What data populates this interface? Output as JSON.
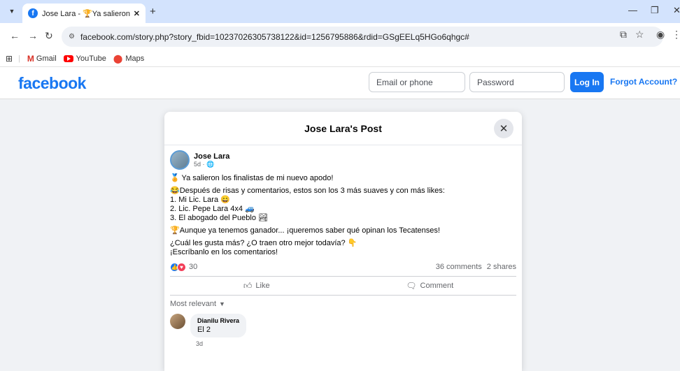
{
  "browser": {
    "tab_title": "Jose Lara - 🏆Ya salieron los fin...",
    "tab_close": "✕",
    "new_tab": "+",
    "url": "facebook.com/story.php?story_fbid=10237026305738122&id=1256795886&rdid=GSgEELq5HGo6qhgc#",
    "bookmarks": [
      "Gmail",
      "YouTube",
      "Maps"
    ]
  },
  "fb_header": {
    "logo": "facebook",
    "email_placeholder": "Email or phone",
    "password_placeholder": "Password",
    "login_label": "Log In",
    "forgot_label": "Forgot Account?"
  },
  "modal": {
    "title": "Jose Lara's Post",
    "close": "✕"
  },
  "post": {
    "author": "Jose Lara",
    "time": "5d · ",
    "lines": [
      "🏅 Ya salieron los finalistas de mi nuevo apodo!",
      "😂Después de risas y comentarios, estos son los 3 más suaves y con más likes:",
      "1. Mi Lic. Lara 😄",
      "2. Lic. Pepe Lara 4x4 🚙",
      "3. El abogado del Pueblo 🏞",
      "🏆Aunque ya tenemos ganador... ¡queremos saber qué opinan los Tecatenses!",
      "¿Cuál les gusta más? ¿O traen otro mejor todavía? 👇",
      "¡Escríbanlo en los comentarios!"
    ],
    "reaction_count": "30",
    "comments_count": "36 comments",
    "shares_count": "2 shares",
    "like_label": "Like",
    "comment_label": "Comment",
    "sort_label": "Most relevant"
  },
  "comments": [
    {
      "name": "Dianilu Rivera",
      "text": "El 2",
      "time": "3d"
    }
  ],
  "colors": {
    "brand": "#1877f2",
    "love": "#f33e58"
  }
}
